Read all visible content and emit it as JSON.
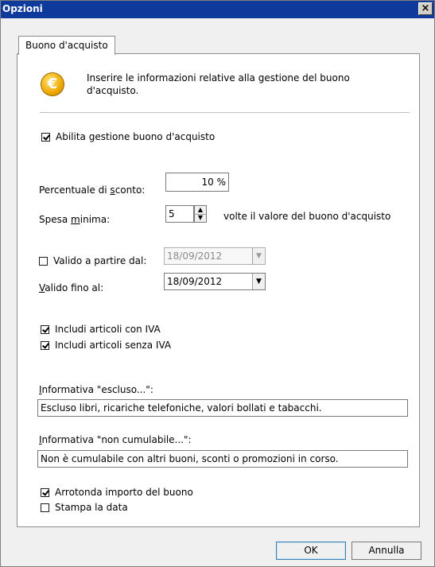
{
  "window": {
    "title": "Opzioni",
    "close_label": "×"
  },
  "tab": {
    "label": "Buono d'acquisto"
  },
  "header": {
    "info_text": "Inserire le informazioni relative alla gestione del buono d'acquisto.",
    "coin_symbol": "€"
  },
  "enable": {
    "label": "Abilita gestione buono d'acquisto",
    "checked": true
  },
  "discount": {
    "label_pre": "Percentuale di ",
    "label_key": "s",
    "label_post": "conto:",
    "value": "10 %"
  },
  "min_spend": {
    "label_pre": "Spesa ",
    "label_key": "m",
    "label_post": "inima:",
    "value": "5",
    "suffix": "volte il valore del buono d'acquisto"
  },
  "valid_from": {
    "label": "Valido a partire dal:",
    "checked": false,
    "date": "18/09/2012"
  },
  "valid_to": {
    "label_key": "V",
    "label_post": "alido fino al:",
    "date": "18/09/2012"
  },
  "vat": {
    "with_label": "Includi articoli con IVA",
    "with_checked": true,
    "without_label": "Includi articoli senza IVA",
    "without_checked": true
  },
  "excluded": {
    "label_key": "I",
    "label_post": "nformativa \"escluso...\":",
    "value": "Escluso libri, ricariche telefoniche, valori bollati e tabacchi."
  },
  "non_cumulative": {
    "label_key": "I",
    "label_post": "nformativa \"non cumulabile...\":",
    "value": "Non è cumulabile con altri buoni, sconti o promozioni in corso."
  },
  "round": {
    "label": "Arrotonda importo del buono",
    "checked": true
  },
  "print_date": {
    "label": "Stampa la data",
    "checked": false
  },
  "buttons": {
    "ok": "OK",
    "cancel": "Annulla"
  },
  "icons": {
    "spin_up": "▲",
    "spin_down": "▼",
    "dropdown": "▼"
  },
  "colors": {
    "titlebar": "#0e3a9c",
    "coin": "#f0a800"
  }
}
